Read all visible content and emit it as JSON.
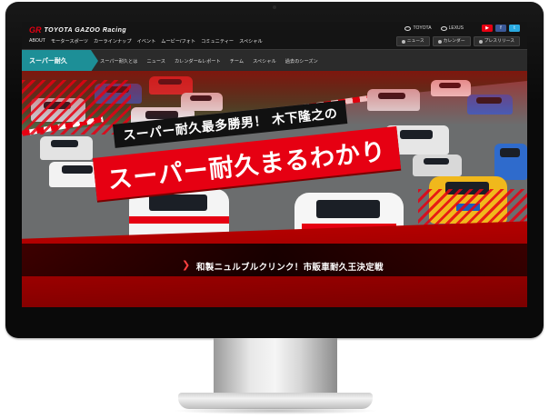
{
  "header": {
    "logo_mark": "GR",
    "logo_text": "TOYOTA GAZOO Racing",
    "nav": [
      "ABOUT",
      "モータースポーツ",
      "カーラインナップ",
      "イベント",
      "ムービー/フォト",
      "コミュニティー",
      "スペシャル"
    ],
    "brands": [
      "TOYOTA",
      "LEXUS"
    ],
    "social": [
      "▶",
      "f",
      "t"
    ],
    "utility": [
      "ニュース",
      "カレンダー",
      "プレスリリース"
    ]
  },
  "subnav": {
    "title": "スーパー耐久",
    "items": [
      "スーパー耐久とは",
      "ニュース",
      "カレンダー&レポート",
      "チーム",
      "スペシャル",
      "過去のシーズン"
    ]
  },
  "hero": {
    "title_small": "スーパー耐久最多勝男！ 木下隆之の",
    "title_big": "スーパー耐久まるわかり",
    "chevron": "❯",
    "tagline": "和製ニュルブルクリンク！市販車耐久王決定戦"
  },
  "colors": {
    "accent_red": "#e60012",
    "subnav_teal": "#1d8f97",
    "header_bg": "#141414"
  }
}
